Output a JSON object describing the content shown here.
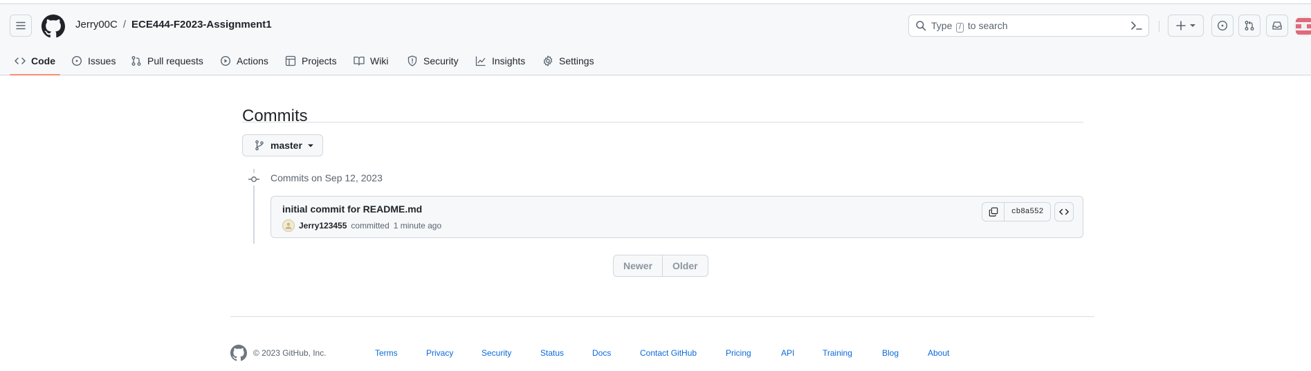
{
  "header": {
    "owner": "Jerry00C",
    "separator": "/",
    "repo": "ECE444-F2023-Assignment1",
    "search": {
      "prefix": "Type",
      "key": "/",
      "suffix": "to search"
    },
    "icons": [
      "hamburger-icon",
      "github-logo-icon",
      "search-icon",
      "terminal-icon",
      "plus-icon",
      "caret-down-icon",
      "issue-opened-icon",
      "git-pull-request-icon",
      "inbox-icon"
    ]
  },
  "tabs": [
    {
      "label": "Code",
      "icon": "code-icon",
      "active": true
    },
    {
      "label": "Issues",
      "icon": "issue-opened-icon"
    },
    {
      "label": "Pull requests",
      "icon": "git-pull-request-icon"
    },
    {
      "label": "Actions",
      "icon": "play-icon"
    },
    {
      "label": "Projects",
      "icon": "table-icon"
    },
    {
      "label": "Wiki",
      "icon": "book-icon"
    },
    {
      "label": "Security",
      "icon": "shield-icon"
    },
    {
      "label": "Insights",
      "icon": "graph-icon"
    },
    {
      "label": "Settings",
      "icon": "gear-icon"
    }
  ],
  "main": {
    "title": "Commits",
    "branch": "master",
    "group_date": "Commits on Sep 12, 2023",
    "commit": {
      "message": "initial commit for README.md",
      "author": "Jerry123455",
      "action": "committed",
      "time": "1 minute ago",
      "sha": "cb8a552"
    },
    "pager": {
      "newer": "Newer",
      "older": "Older"
    }
  },
  "footer": {
    "copyright": "© 2023 GitHub, Inc.",
    "links": [
      "Terms",
      "Privacy",
      "Security",
      "Status",
      "Docs",
      "Contact GitHub",
      "Pricing",
      "API",
      "Training",
      "Blog",
      "About"
    ]
  },
  "colors": {
    "header_bg": "#f6f8fa",
    "border": "#d0d7de",
    "active_tab_underline": "#fd8c73",
    "link": "#0969da",
    "muted_text": "#59636e"
  }
}
